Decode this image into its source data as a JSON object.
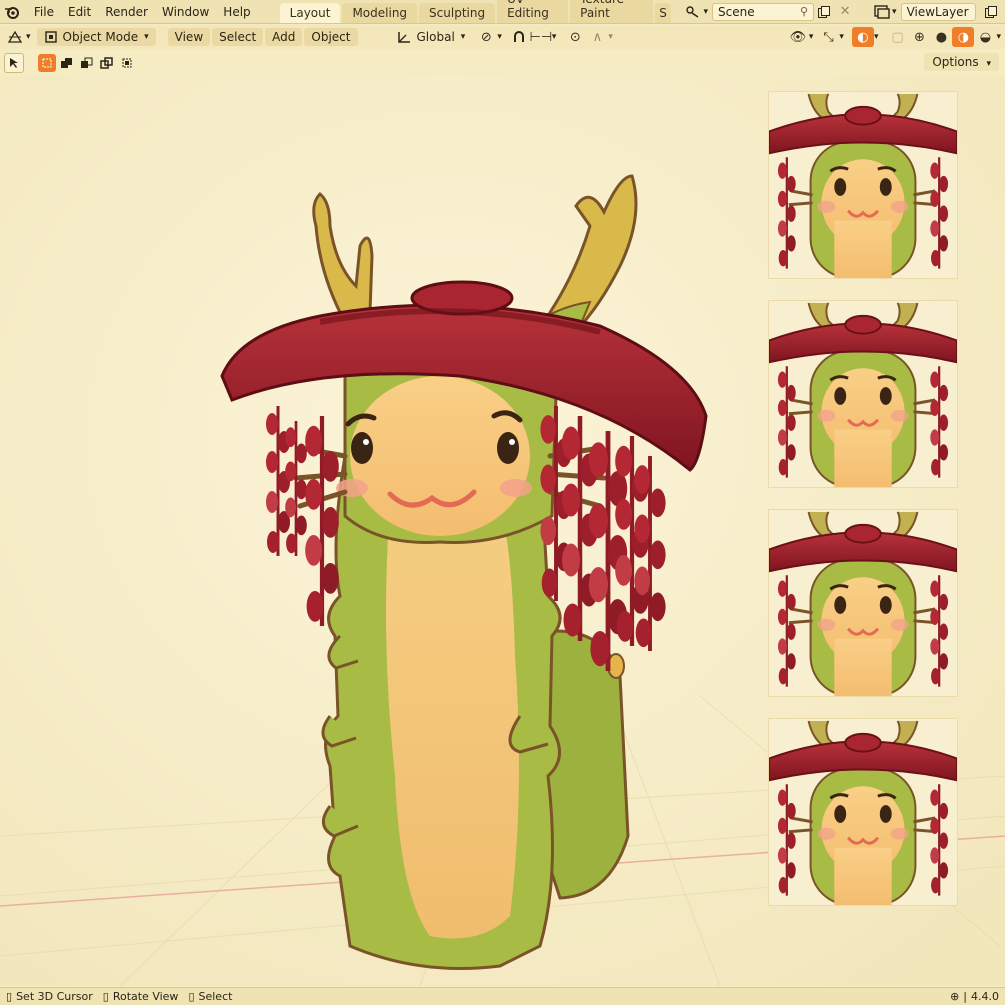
{
  "menu": [
    "File",
    "Edit",
    "Render",
    "Window",
    "Help"
  ],
  "workspace_tabs": [
    {
      "label": "Layout",
      "active": true
    },
    {
      "label": "Modeling",
      "active": false
    },
    {
      "label": "Sculpting",
      "active": false
    },
    {
      "label": "UV Editing",
      "active": false
    },
    {
      "label": "Texture Paint",
      "active": false
    },
    {
      "label": "S",
      "active": false
    }
  ],
  "scene_name": "Scene",
  "view_layer_name": "ViewLayer",
  "header": {
    "mode_label": "Object Mode",
    "view_label": "View",
    "select_label": "Select",
    "add_label": "Add",
    "object_label": "Object",
    "orientation_label": "Global"
  },
  "options_label": "Options",
  "status": {
    "hint1": "Set 3D Cursor",
    "hint2": "Rotate View",
    "hint3": "Select",
    "version": "4.4.0"
  },
  "colors": {
    "accent": "#f07d28",
    "hat": "#a21f28",
    "body_green": "#a8bb44",
    "belly": "#f7c47a",
    "background": "#f6ecc4"
  }
}
